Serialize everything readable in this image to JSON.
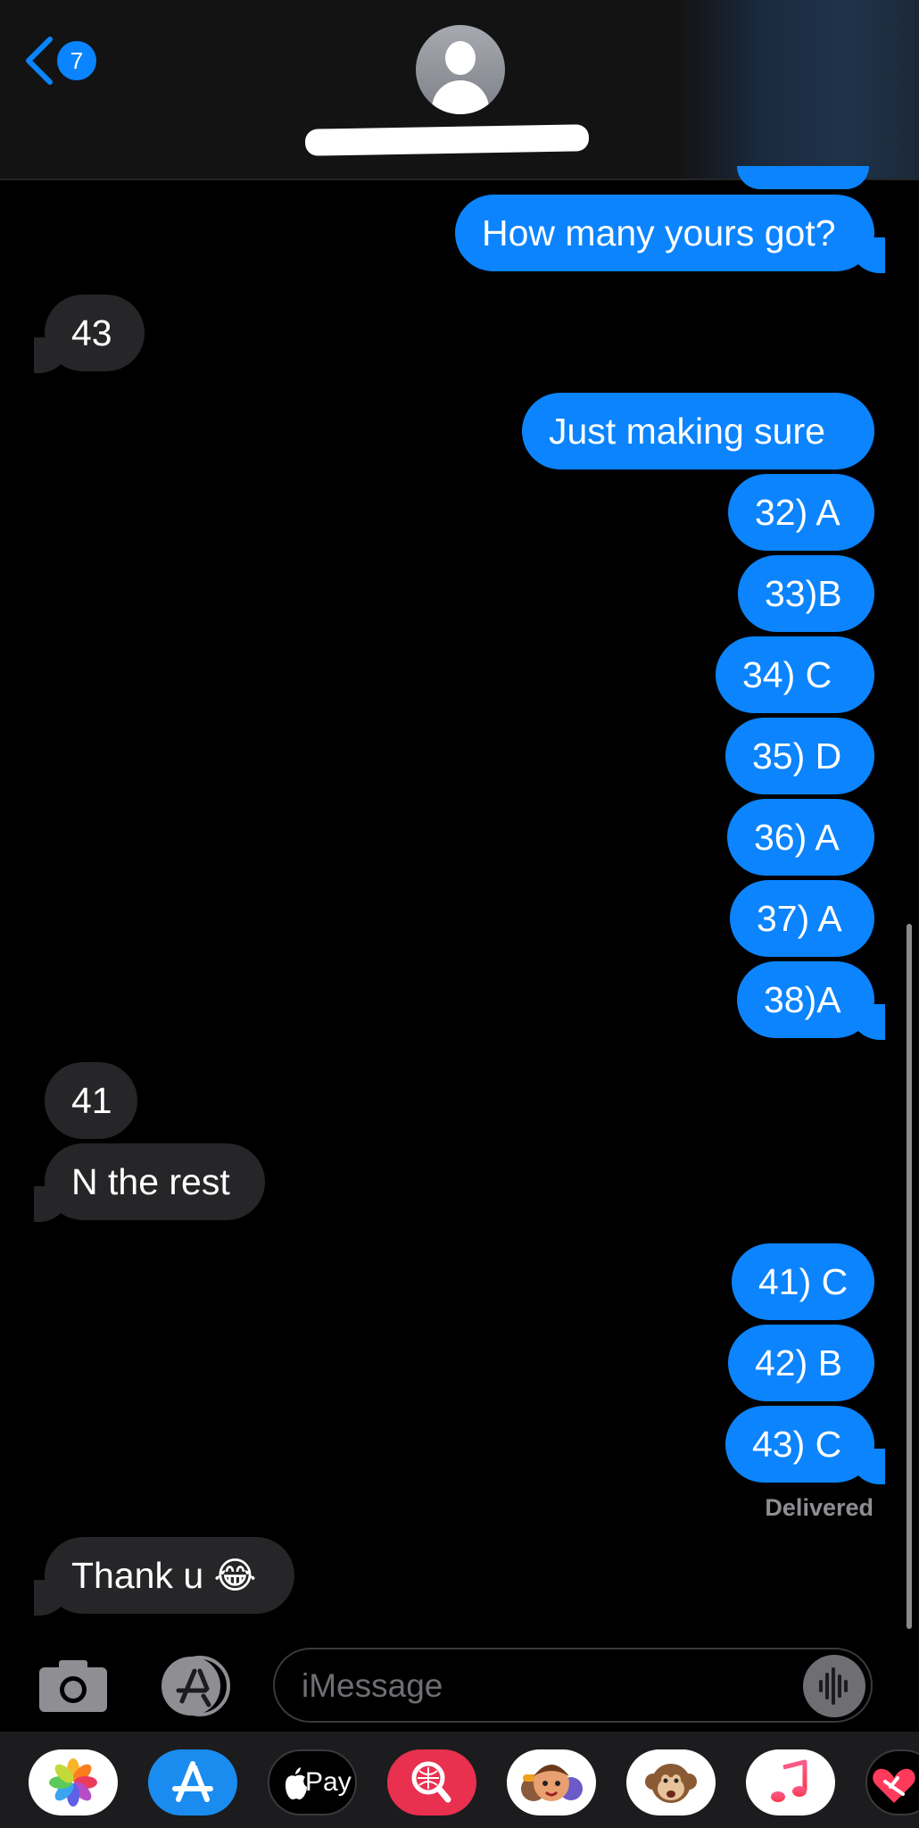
{
  "header": {
    "back_count": "7"
  },
  "messages": [
    {
      "id": "m1",
      "dir": "out",
      "text": "How many yours got?",
      "tail": true
    },
    {
      "id": "m2",
      "dir": "in",
      "text": "43",
      "tail": true
    },
    {
      "id": "m3",
      "dir": "out",
      "text": "Just making sure",
      "tail": false
    },
    {
      "id": "m4",
      "dir": "out",
      "text": "32) A",
      "tail": false
    },
    {
      "id": "m5",
      "dir": "out",
      "text": "33)B",
      "tail": false
    },
    {
      "id": "m6",
      "dir": "out",
      "text": "34) C",
      "tail": false
    },
    {
      "id": "m7",
      "dir": "out",
      "text": "35) D",
      "tail": false
    },
    {
      "id": "m8",
      "dir": "out",
      "text": "36) A",
      "tail": false
    },
    {
      "id": "m9",
      "dir": "out",
      "text": "37) A",
      "tail": false
    },
    {
      "id": "m10",
      "dir": "out",
      "text": "38)A",
      "tail": true
    },
    {
      "id": "m11",
      "dir": "in",
      "text": "41",
      "tail": false
    },
    {
      "id": "m12",
      "dir": "in",
      "text": "N the rest",
      "tail": true
    },
    {
      "id": "m13",
      "dir": "out",
      "text": "41) C",
      "tail": false
    },
    {
      "id": "m14",
      "dir": "out",
      "text": "42) B",
      "tail": false
    },
    {
      "id": "m15",
      "dir": "out",
      "text": "43) C",
      "tail": true
    },
    {
      "id": "m16",
      "dir": "in",
      "text": "Thank u 😂",
      "tail": true
    }
  ],
  "status": {
    "delivered": "Delivered"
  },
  "composer": {
    "placeholder": "iMessage"
  },
  "drawer": {
    "apple_pay_label": "Pay",
    "apps": [
      "photos-icon",
      "app-store-icon",
      "apple-pay-icon",
      "image-search-icon",
      "memoji-icon",
      "animoji-monkey-icon",
      "music-icon",
      "digital-touch-icon"
    ]
  },
  "colors": {
    "outgoing_bubble": "#0b84fe",
    "incoming_bubble": "#262628",
    "background": "#000000"
  }
}
